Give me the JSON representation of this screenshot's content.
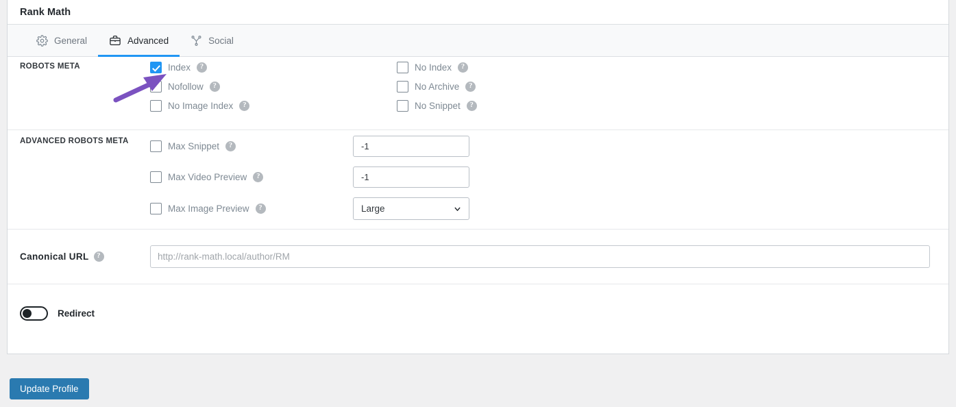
{
  "header": {
    "title": "Rank Math"
  },
  "tabs": [
    {
      "label": "General",
      "icon": "gear-icon",
      "active": false
    },
    {
      "label": "Advanced",
      "icon": "briefcase-icon",
      "active": true
    },
    {
      "label": "Social",
      "icon": "share-icon",
      "active": false
    }
  ],
  "robots_meta": {
    "section_label": "ROBOTS META",
    "left_column": [
      {
        "label": "Index",
        "checked": true,
        "help": "?"
      },
      {
        "label": "Nofollow",
        "checked": false,
        "help": "?"
      },
      {
        "label": "No Image Index",
        "checked": false,
        "help": "?"
      }
    ],
    "right_column": [
      {
        "label": "No Index",
        "checked": false,
        "help": "?"
      },
      {
        "label": "No Archive",
        "checked": false,
        "help": "?"
      },
      {
        "label": "No Snippet",
        "checked": false,
        "help": "?"
      }
    ]
  },
  "advanced_robots_meta": {
    "section_label": "ADVANCED ROBOTS META",
    "rows": [
      {
        "label": "Max Snippet",
        "checked": false,
        "help": "?",
        "value": "-1",
        "control": "text"
      },
      {
        "label": "Max Video Preview",
        "checked": false,
        "help": "?",
        "value": "-1",
        "control": "text"
      },
      {
        "label": "Max Image Preview",
        "checked": false,
        "help": "?",
        "value": "Large",
        "control": "select"
      }
    ]
  },
  "canonical": {
    "label": "Canonical URL",
    "help": "?",
    "value": "",
    "placeholder": "http://rank-math.local/author/RM"
  },
  "redirect": {
    "label": "Redirect",
    "enabled": false
  },
  "submit": {
    "label": "Update Profile"
  },
  "annotation": {
    "type": "arrow",
    "color": "#7b52c0",
    "points_to": "index-checkbox"
  },
  "colors": {
    "accent_blue": "#2196f3",
    "button_blue": "#2a7ab0",
    "annotation_purple": "#7b52c0",
    "label_gray": "#7e8993",
    "page_bg": "#f0f0f1"
  }
}
